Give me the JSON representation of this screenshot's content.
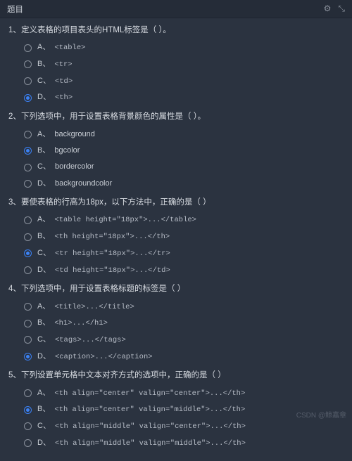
{
  "header": {
    "title": "题目"
  },
  "watermark": "CSDN @鲸嘉章",
  "questions": [
    {
      "num": "1、",
      "stem": "定义表格的项目表头的HTML标签是（   ）。",
      "selected": 3,
      "options": [
        {
          "letter": "A、",
          "text": "<table>",
          "code": true
        },
        {
          "letter": "B、",
          "text": "<tr>",
          "code": true
        },
        {
          "letter": "C、",
          "text": "<td>",
          "code": true
        },
        {
          "letter": "D、",
          "text": "<th>",
          "code": true
        }
      ]
    },
    {
      "num": "2、",
      "stem": "下列选项中，用于设置表格背景颜色的属性是（   ）。",
      "selected": 1,
      "options": [
        {
          "letter": "A、",
          "text": "background",
          "code": false
        },
        {
          "letter": "B、",
          "text": "bgcolor",
          "code": false
        },
        {
          "letter": "C、",
          "text": "bordercolor",
          "code": false
        },
        {
          "letter": "D、",
          "text": "backgroundcolor",
          "code": false
        }
      ]
    },
    {
      "num": "3、",
      "stem": "要使表格的行高为18px，以下方法中，正确的是（   ）",
      "selected": 2,
      "options": [
        {
          "letter": "A、",
          "text": "<table height=\"18px\">...</table>",
          "code": true
        },
        {
          "letter": "B、",
          "text": "<th height=\"18px\">...</th>",
          "code": true
        },
        {
          "letter": "C、",
          "text": "<tr height=\"18px\">...</tr>",
          "code": true
        },
        {
          "letter": "D、",
          "text": "<td height=\"18px\">...</td>",
          "code": true
        }
      ]
    },
    {
      "num": "4、",
      "stem": "下列选项中，用于设置表格标题的标签是（   ）",
      "selected": 3,
      "options": [
        {
          "letter": "A、",
          "text": "<title>...</title>",
          "code": true
        },
        {
          "letter": "B、",
          "text": "<h1>...</h1>",
          "code": true
        },
        {
          "letter": "C、",
          "text": "<tags>...</tags>",
          "code": true
        },
        {
          "letter": "D、",
          "text": "<caption>...</caption>",
          "code": true
        }
      ]
    },
    {
      "num": "5、",
      "stem": "下列设置单元格中文本对齐方式的选项中，正确的是（   ）",
      "selected": 1,
      "options": [
        {
          "letter": "A、",
          "text": "<th align=\"center\" valign=\"center\">...</th>",
          "code": true
        },
        {
          "letter": "B、",
          "text": "<th align=\"center\" valign=\"middle\">...</th>",
          "code": true
        },
        {
          "letter": "C、",
          "text": "<th align=\"middle\" valign=\"center\">...</th>",
          "code": true
        },
        {
          "letter": "D、",
          "text": "<th align=\"middle\" valign=\"middle\">...</th>",
          "code": true
        }
      ]
    }
  ]
}
